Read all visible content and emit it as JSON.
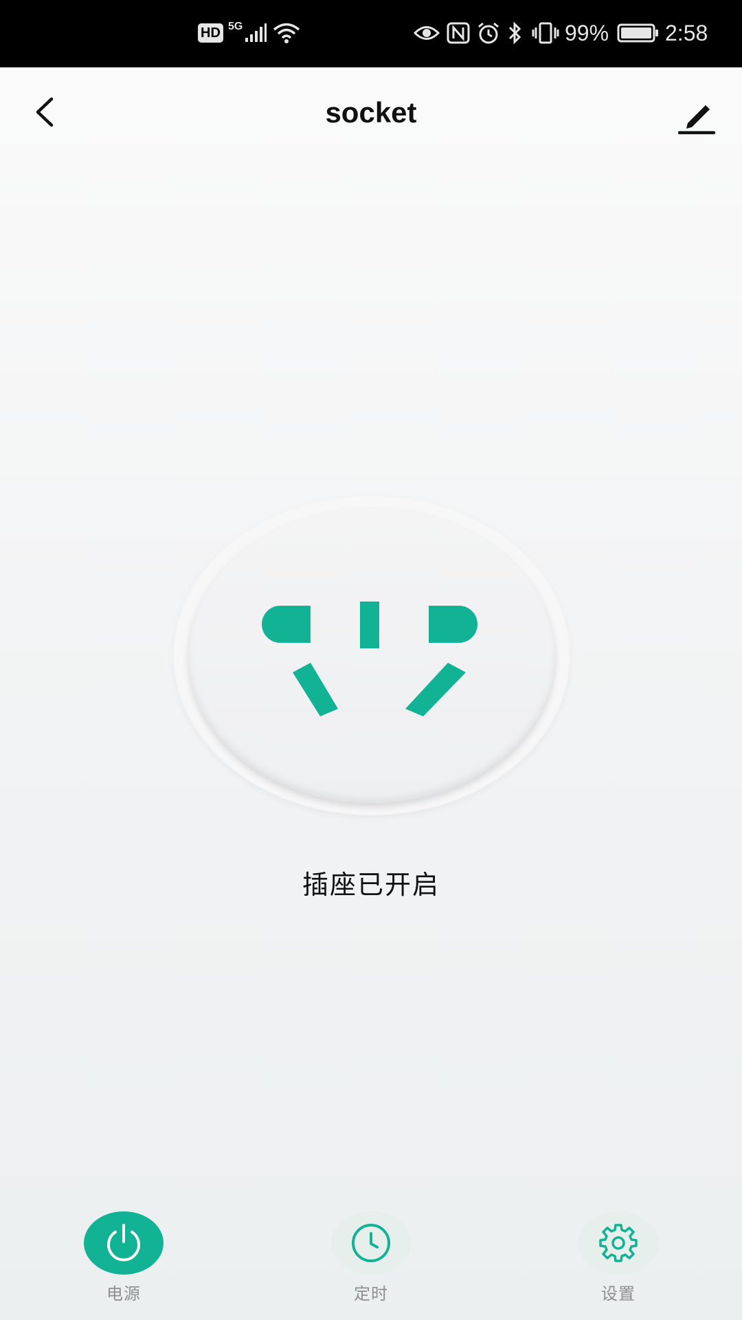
{
  "status_bar": {
    "hd": "HD",
    "network": "5G",
    "battery_percent": "99%",
    "time": "2:58"
  },
  "header": {
    "title": "socket"
  },
  "socket": {
    "state_text": "插座已开启",
    "is_on": true
  },
  "nav": {
    "items": [
      {
        "label": "电源",
        "icon": "power-icon",
        "active": true
      },
      {
        "label": "定时",
        "icon": "clock-icon",
        "active": false
      },
      {
        "label": "设置",
        "icon": "gear-icon",
        "active": false
      }
    ]
  },
  "colors": {
    "accent": "#12b394",
    "accent_light": "#e6efec"
  }
}
